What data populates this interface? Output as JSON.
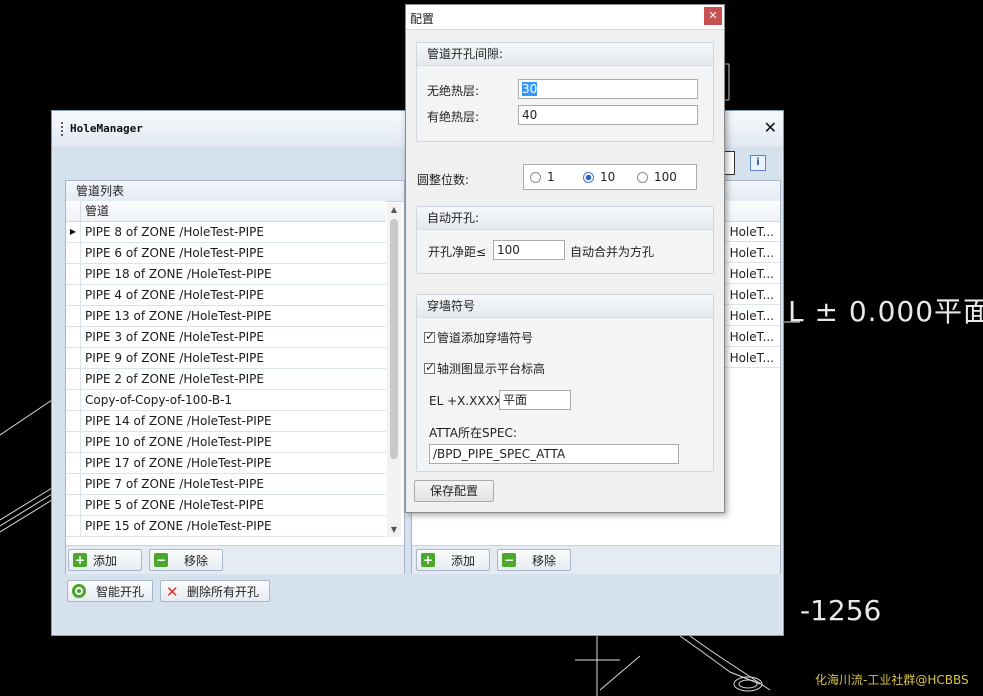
{
  "colors": {
    "accent": "#3399ff",
    "add_icon": "#4ca82a",
    "delete_icon": "#e0311f",
    "close_button": "#c75050",
    "watermark": "#d8c24a"
  },
  "cad": {
    "elevation_text": "L ± 0.000平面",
    "number_text": "-1256"
  },
  "watermark": "化海川流-工业社群@HCBBS",
  "hole_manager": {
    "title": "HoleManager",
    "close_icon": "close-icon",
    "pipe_list": {
      "header": "管道列表",
      "column": "管道",
      "rows": [
        "PIPE 8 of ZONE /HoleTest-PIPE",
        "PIPE 6 of ZONE /HoleTest-PIPE",
        "PIPE 18 of ZONE /HoleTest-PIPE",
        "PIPE 4 of ZONE /HoleTest-PIPE",
        "PIPE 13 of ZONE /HoleTest-PIPE",
        "PIPE 3 of ZONE /HoleTest-PIPE",
        "PIPE 9 of ZONE /HoleTest-PIPE",
        "PIPE 2 of ZONE /HoleTest-PIPE",
        "Copy-of-Copy-of-100-B-1",
        "PIPE 14 of ZONE /HoleTest-PIPE",
        "PIPE 10 of ZONE /HoleTest-PIPE",
        "PIPE 17 of ZONE /HoleTest-PIPE",
        "PIPE 7 of ZONE /HoleTest-PIPE",
        "PIPE 5 of ZONE /HoleTest-PIPE",
        "PIPE 15 of ZONE /HoleTest-PIPE"
      ],
      "current_row_marker": "▶",
      "add_label": "添加",
      "remove_label": "移除"
    },
    "right_list": {
      "rows": [
        "HoleT...",
        "HoleT...",
        "HoleT...",
        "HoleT...",
        "HoleT...",
        "HoleT...",
        "HoleT..."
      ],
      "add_label": "添加",
      "remove_label": "移除"
    },
    "smart_hole_label": "智能开孔",
    "delete_all_label": "删除所有开孔",
    "info_icon": "info-icon"
  },
  "config": {
    "title": "配置",
    "gap_group": {
      "title": "管道开孔间隙:",
      "no_insulation_label": "无绝热层:",
      "no_insulation_value": "30",
      "with_insulation_label": "有绝热层:",
      "with_insulation_value": "40"
    },
    "rounding": {
      "label": "圆整位数:",
      "options": [
        "1",
        "10",
        "100"
      ],
      "selected": "10"
    },
    "auto_hole": {
      "title": "自动开孔:",
      "clearance_label": "开孔净距≤",
      "clearance_value": "100",
      "merge_label": "自动合并为方孔"
    },
    "wall_symbol": {
      "title": "穿墙符号",
      "add_symbol_label": "管道添加穿墙符号",
      "add_symbol_checked": true,
      "show_elev_label": "轴测图显示平台标高",
      "show_elev_checked": true,
      "el_label": "EL +X.XXXX",
      "el_value": "平面",
      "atta_label": "ATTA所在SPEC:",
      "atta_value": "/BPD_PIPE_SPEC_ATTA"
    },
    "save_label": "保存配置"
  }
}
